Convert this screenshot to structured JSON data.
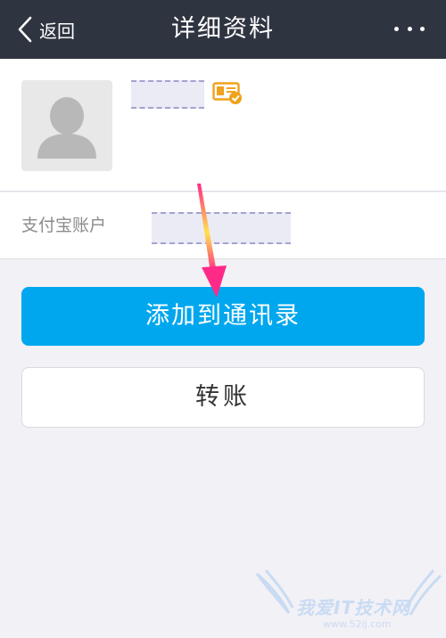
{
  "header": {
    "back_label": "返回",
    "title": "详细资料",
    "more_icon": "more-icon"
  },
  "profile": {
    "avatar_icon": "default-avatar-icon",
    "verify_icon": "id-card-verified-icon"
  },
  "account": {
    "label": "支付宝账户"
  },
  "actions": {
    "add_contact_label": "添加到通讯录",
    "transfer_label": "转账"
  },
  "watermark": {
    "text": "我爱IT技术网",
    "url": "www.52ij.com"
  },
  "colors": {
    "header_bg": "#2f3441",
    "page_bg": "#f2f1f6",
    "primary_blue": "#00a7ee",
    "annotation_arrow": "#ff2a88"
  }
}
